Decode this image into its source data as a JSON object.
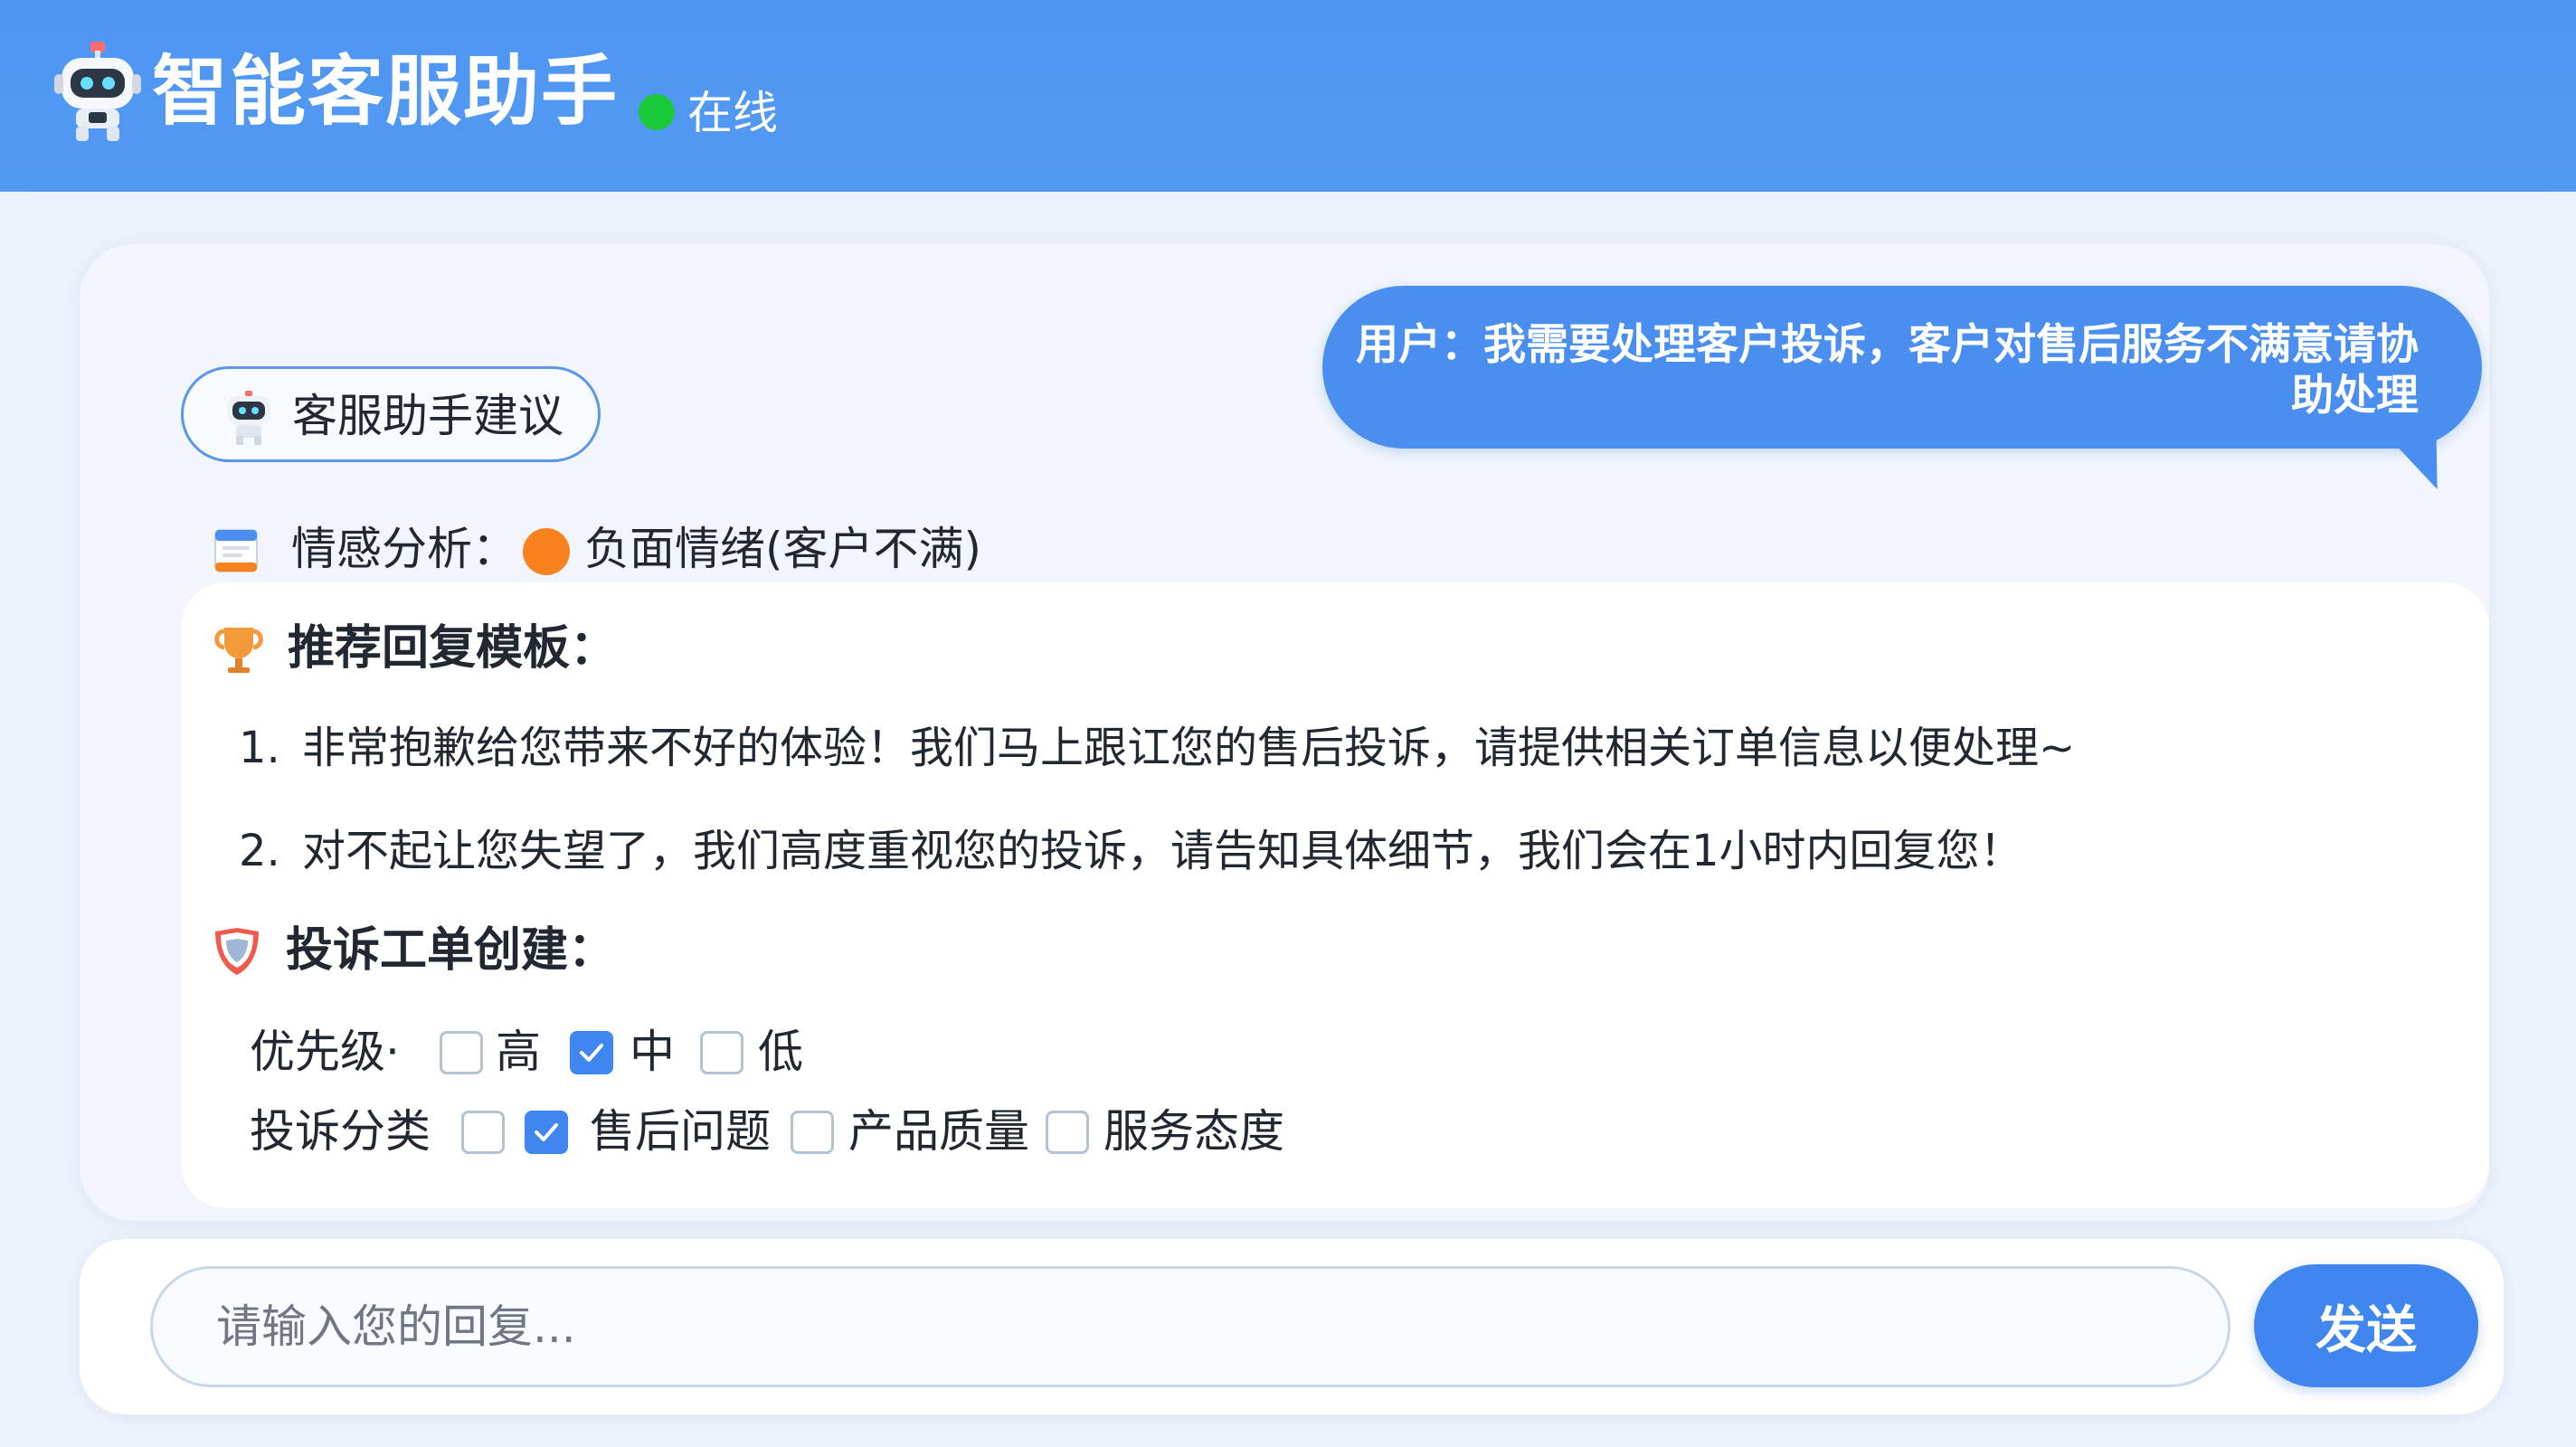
{
  "header": {
    "title": "智能客服助手",
    "status_text": "在线",
    "status_color": "#19c93a",
    "robot_icon": "robot-icon"
  },
  "user_message": {
    "text": "用户：我需要处理客户投诉，客户对售后服务不满意请协助处理"
  },
  "assistant": {
    "tag_label": "客服助手建议",
    "tag_icon": "robot-icon"
  },
  "sentiment": {
    "label": "情感分析：",
    "value": "负面情绪(客户不满)",
    "dot_color": "#f8821e",
    "icon": "clipboard-icon"
  },
  "templates": {
    "label": "推荐回复模板：",
    "icon": "trophy-icon",
    "items": [
      {
        "num": "1.",
        "text": "非常抱歉给您带来不好的体验！我们马上跟讧您的售后投诉，请提供相关订单信息以便处理~"
      },
      {
        "num": "2.",
        "text": "对不起让您失望了，我们高度重视您的投诉，请告知具体细节，我们会在1小时内回复您！"
      }
    ]
  },
  "ticket": {
    "label": "投诉工单创建：",
    "icon": "shield-icon",
    "priority": {
      "label": "优先级·",
      "options": [
        {
          "label": "高",
          "checked": false
        },
        {
          "label": "中",
          "checked": true
        },
        {
          "label": "低",
          "checked": false
        }
      ]
    },
    "category": {
      "label": "投诉分类",
      "options": [
        {
          "label": "",
          "checked": false
        },
        {
          "label": "售后问题",
          "checked": true
        },
        {
          "label": "产品质量",
          "checked": false
        },
        {
          "label": "服务态度",
          "checked": false
        }
      ]
    }
  },
  "composer": {
    "placeholder": "请输入您的回复...",
    "send_label": "发送"
  },
  "colors": {
    "header": "#4e96f3",
    "accent": "#3f86ee",
    "bubble": "#4a8ff0"
  }
}
